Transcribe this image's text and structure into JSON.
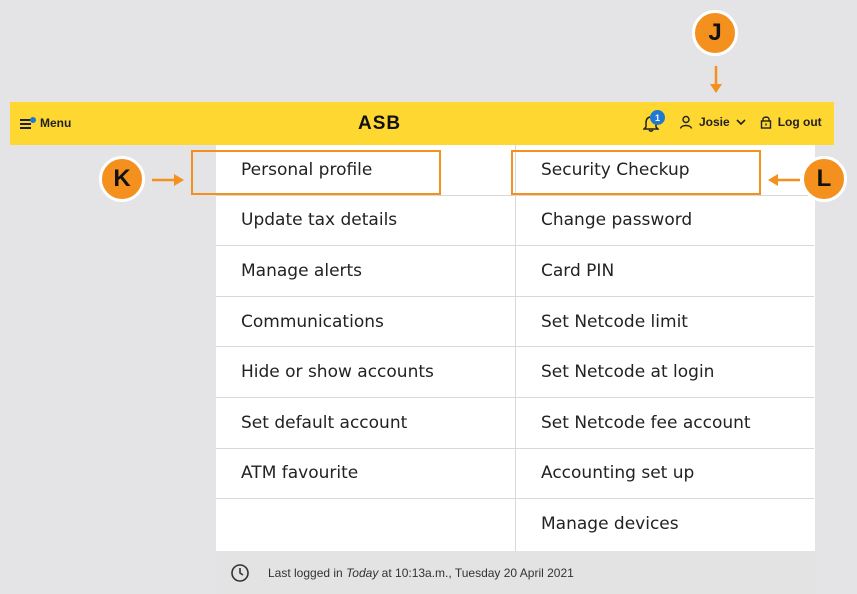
{
  "header": {
    "menu_label": "Menu",
    "logo_text": "ASB",
    "notifications_count": "1",
    "user_name": "Josie",
    "logout_label": "Log out"
  },
  "menu": {
    "left": [
      "Personal profile",
      "Update tax details",
      "Manage alerts",
      "Communications",
      "Hide or show accounts",
      "Set default account",
      "ATM favourite"
    ],
    "right": [
      "Security Checkup",
      "Change password",
      "Card PIN",
      "Set Netcode limit",
      "Set Netcode at login",
      "Set Netcode fee account",
      "Accounting set up",
      "Manage devices"
    ]
  },
  "footer": {
    "prefix": "Last logged in",
    "today": "Today",
    "suffix": "at 10:13a.m., Tuesday 20 April 2021"
  },
  "callouts": {
    "j": "J",
    "k": "K",
    "l": "L"
  },
  "colors": {
    "header_bg": "#ffd731",
    "callout": "#f4901e",
    "badge": "#1f78d1"
  }
}
